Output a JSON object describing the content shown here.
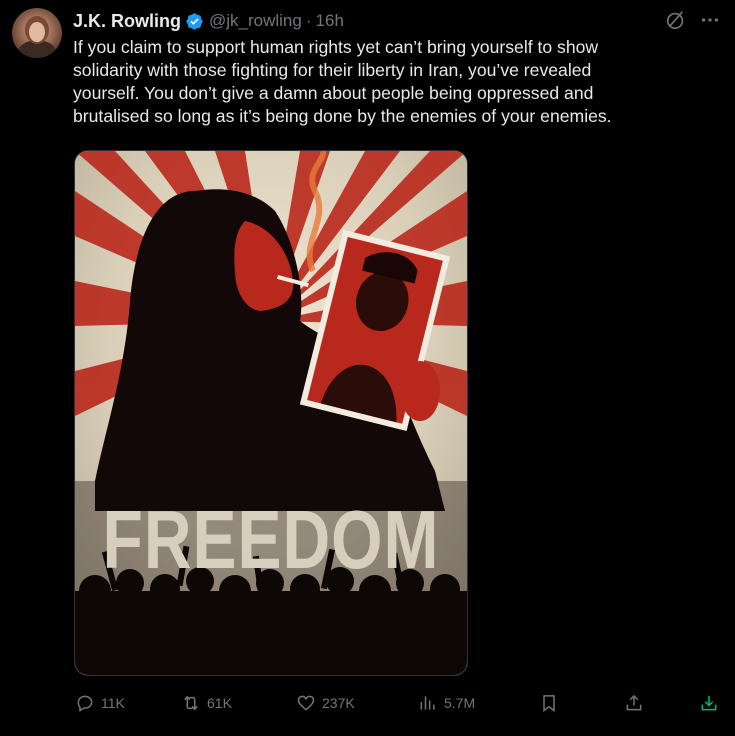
{
  "author": {
    "name": "J.K. Rowling",
    "handle": "@jk_rowling",
    "separator": "·",
    "time": "16h",
    "verified": true
  },
  "tweet": {
    "text": "If you claim to support human rights yet can’t bring yourself to show\nsolidarity with those fighting for their liberty in Iran, you’ve revealed\nyourself. You don’t give a damn about people being oppressed and\nbrutalised so long as it’s being done by the enemies of your enemies."
  },
  "media": {
    "poster_text": "FREEDOM"
  },
  "actions": {
    "replies": "11K",
    "retweets": "61K",
    "likes": "237K",
    "views": "5.7M"
  },
  "icons": [
    "grok-icon",
    "more-icon",
    "reply-icon",
    "retweet-icon",
    "like-icon",
    "views-icon",
    "bookmark-icon",
    "share-icon",
    "download-icon"
  ],
  "colors": {
    "background": "#000000",
    "text": "#e7e9ea",
    "muted": "#71767b",
    "verified": "#1d9bf0",
    "download": "#00ba7c",
    "poster_red": "#b8281c",
    "poster_cream": "#d7cfbd"
  }
}
